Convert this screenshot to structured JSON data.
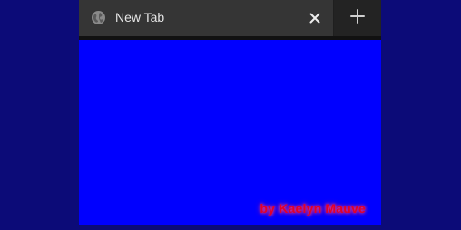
{
  "tab": {
    "title": "New Tab",
    "icon": "globe-icon",
    "close_icon": "close-icon"
  },
  "newtab": {
    "icon": "plus-icon"
  },
  "content": {
    "background": "#0000ff",
    "watermark": "by Kaelyn Mauve"
  },
  "colors": {
    "page_background": "#0c0b78",
    "tab_active": "#353535",
    "tabstrip": "#1f1f1f",
    "watermark": "#e0002a"
  }
}
